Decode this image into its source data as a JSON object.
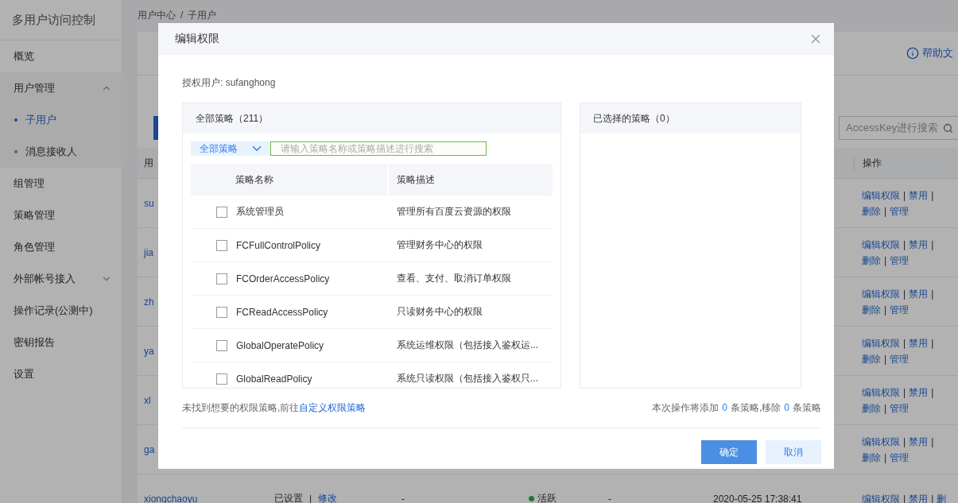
{
  "sidebar": {
    "title": "多用户访问控制",
    "items": [
      {
        "label": "概览",
        "selected": false
      },
      {
        "label": "用户管理",
        "selected": false,
        "expanded": true,
        "children": [
          {
            "label": "子用户",
            "selected": true
          },
          {
            "label": "消息接收人",
            "selected": false
          }
        ]
      },
      {
        "label": "组管理",
        "selected": false
      },
      {
        "label": "策略管理",
        "selected": false
      },
      {
        "label": "角色管理",
        "selected": false
      },
      {
        "label": "外部帐号接入",
        "selected": false,
        "expanded": false
      },
      {
        "label": "操作记录(公测中)",
        "selected": false
      },
      {
        "label": "密钥报告",
        "selected": false
      },
      {
        "label": "设置",
        "selected": false
      }
    ]
  },
  "breadcrumb": {
    "items": [
      "用户中心",
      "子用户"
    ],
    "separator": "/"
  },
  "help_link": "帮助文",
  "search": {
    "placeholder": "AccessKey进行搜索"
  },
  "user_table": {
    "columns": [
      "用",
      "操作"
    ],
    "separator": "|",
    "rows": [
      {
        "name": "su",
        "actions": [
          "编辑权限",
          "禁用",
          "删除",
          "管理"
        ]
      },
      {
        "name": "jia",
        "actions": [
          "编辑权限",
          "禁用",
          "删除",
          "管理"
        ]
      },
      {
        "name": "zh",
        "actions": [
          "编辑权限",
          "禁用",
          "删除",
          "管理"
        ]
      },
      {
        "name": "ya",
        "actions": [
          "编辑权限",
          "禁用",
          "删除",
          "管理"
        ]
      },
      {
        "name": "xl",
        "actions": [
          "编辑权限",
          "禁用",
          "删除",
          "管理"
        ]
      },
      {
        "name": "ga",
        "actions": [
          "编辑权限",
          "禁用",
          "删除",
          "管理"
        ]
      },
      {
        "name": "xiongchaoyu",
        "password": "已设置",
        "password_action": "修改",
        "column_3": "-",
        "status": "活跃",
        "column_5": "-",
        "created": "2020-05-25 17:38:41",
        "actions": [
          "编辑权限",
          "禁用",
          "删"
        ]
      }
    ]
  },
  "dialog": {
    "title": "编辑权限",
    "user_label": "授权用户: sufanghong",
    "all_policies": {
      "title": "全部策略（211）",
      "filter": "全部策略",
      "search_placeholder": "请输入策略名称或策略描述进行搜索",
      "columns": [
        "策略名称",
        "策略描述"
      ],
      "rows": [
        {
          "name": "系统管理员",
          "description": "管理所有百度云资源的权限",
          "checked": false
        },
        {
          "name": "FCFullControlPolicy",
          "description": "管理财务中心的权限",
          "checked": false
        },
        {
          "name": "FCOrderAccessPolicy",
          "description": "查看、支付、取消订单权限",
          "checked": false
        },
        {
          "name": "FCReadAccessPolicy",
          "description": "只读财务中心的权限",
          "checked": false
        },
        {
          "name": "GlobalOperatePolicy",
          "description": "系统运维权限（包括接入鉴权运...",
          "checked": false
        },
        {
          "name": "GlobalReadPolicy",
          "description": "系统只读权限（包括接入鉴权只...",
          "checked": false
        }
      ]
    },
    "selected_policies": {
      "title": "已选择的策略（0）"
    },
    "footer_text": "未找到想要的权限策略,前往",
    "footer_link": "自定义权限策略",
    "summary": {
      "before": "本次操作将添加",
      "added": "0",
      "middle": "条策略,移除",
      "removed": "0",
      "after": "条策略"
    },
    "buttons": [
      {
        "label": "确定",
        "kind": "primary"
      },
      {
        "label": "取消",
        "kind": "secondary"
      }
    ]
  }
}
